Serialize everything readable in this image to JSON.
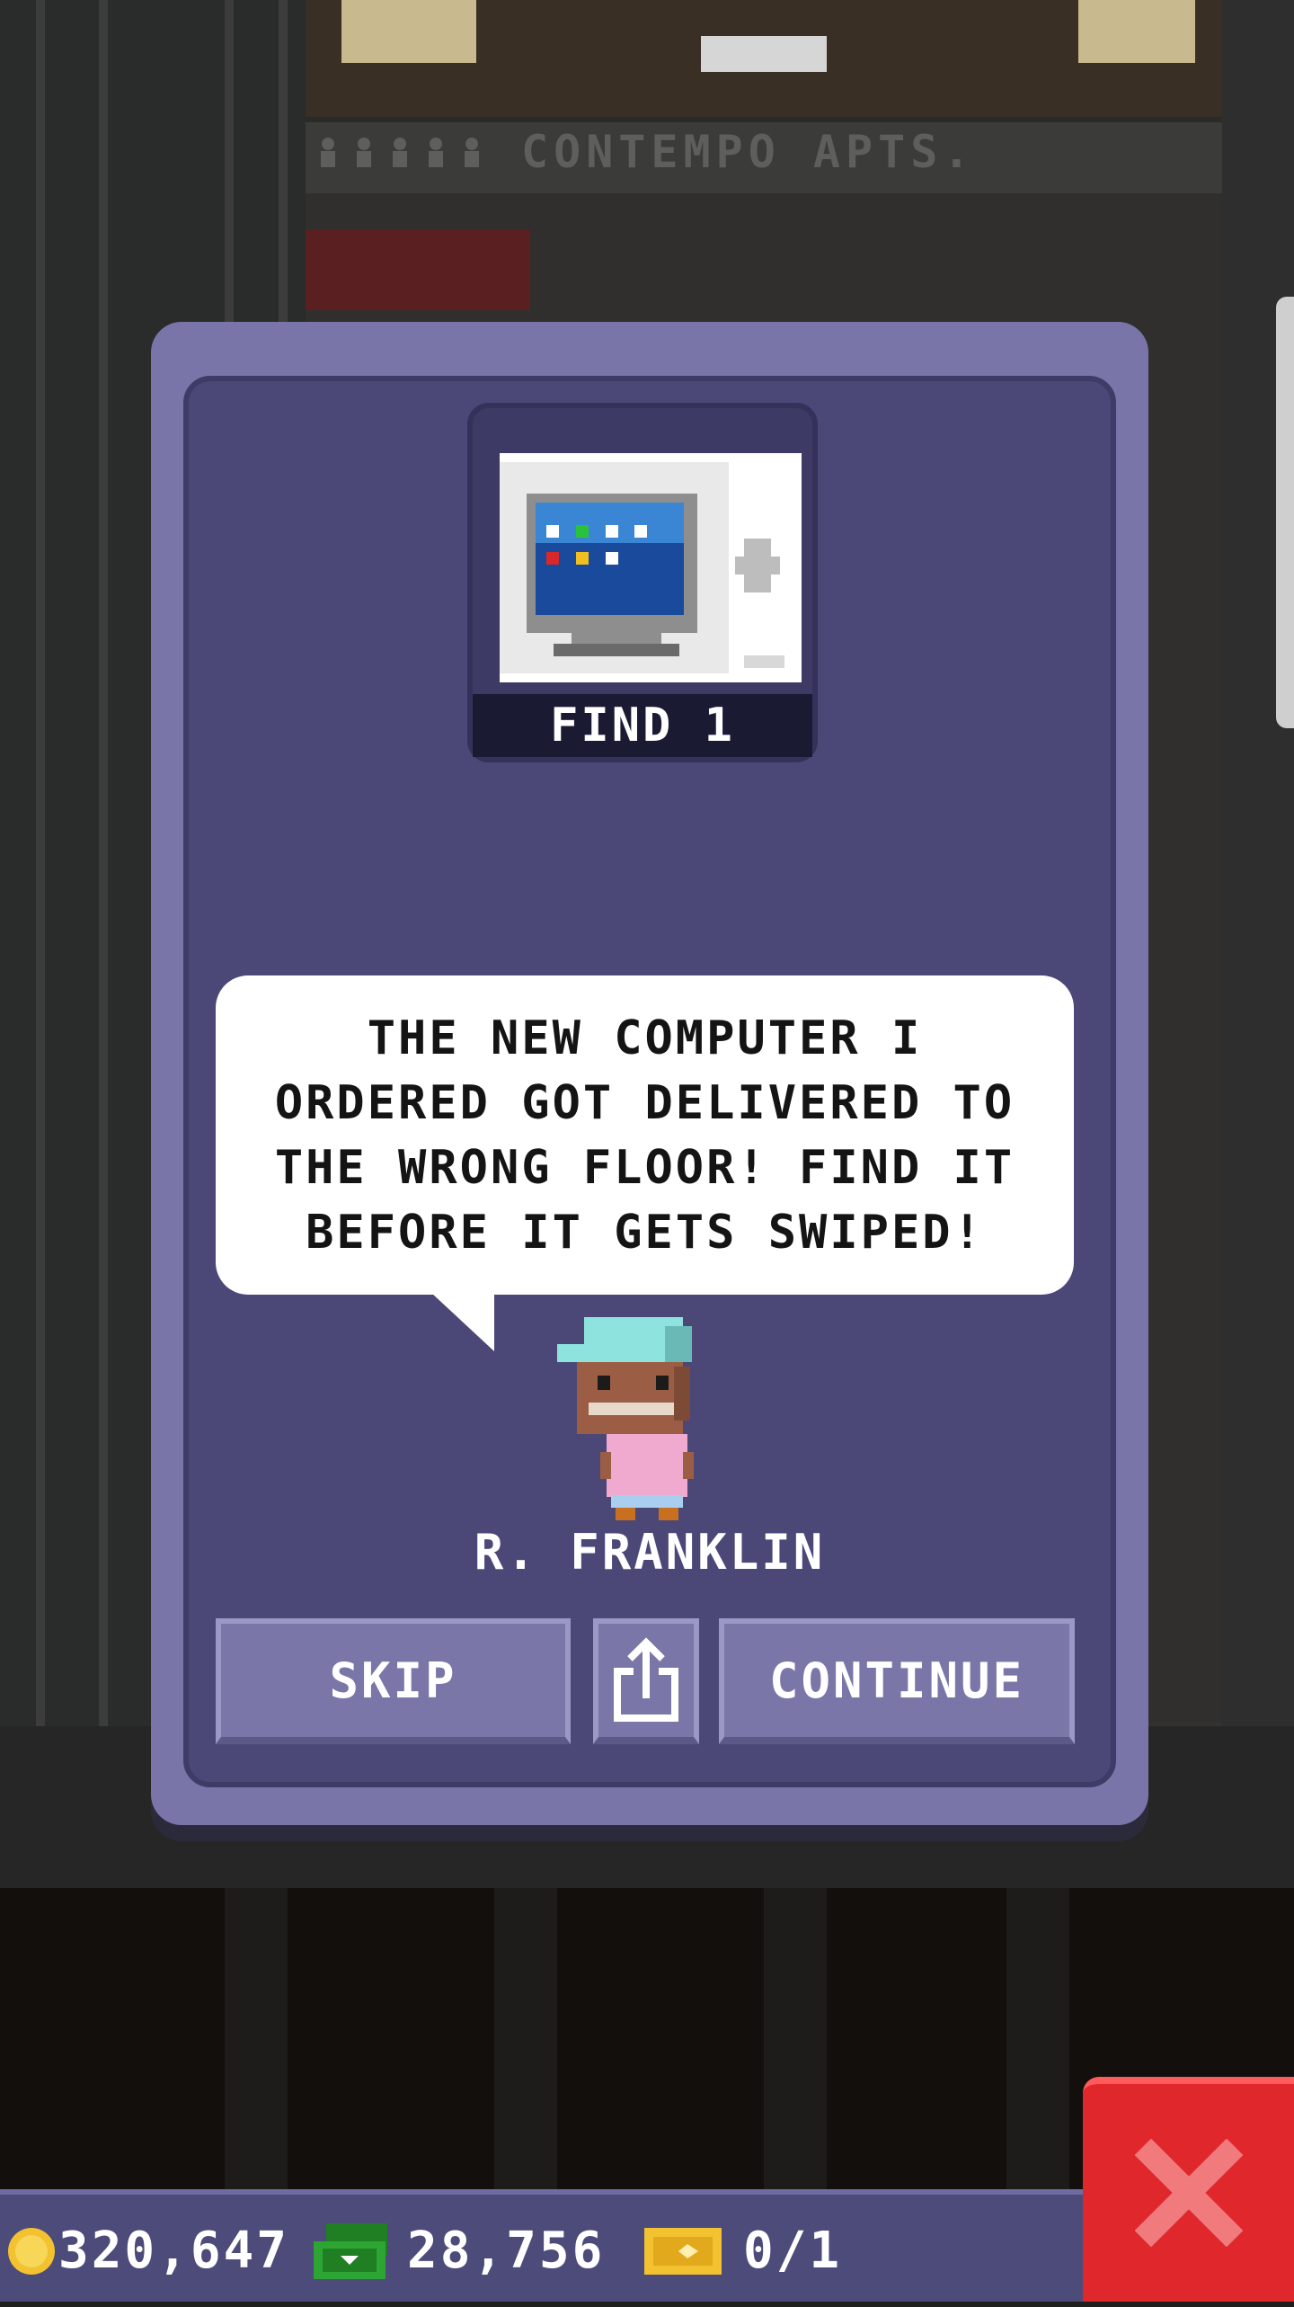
{
  "background": {
    "building_sign": "CONTEMPO APTS."
  },
  "mission": {
    "item_icon": "computer-monitor-icon",
    "find_label": "FIND 1",
    "message": "THE NEW COMPUTER I ORDERED GOT DELIVERED TO THE WRONG FLOOR! FIND IT BEFORE IT GETS SWIPED!",
    "character_name": "R. FRANKLIN"
  },
  "buttons": {
    "skip": "SKIP",
    "share_icon": "share-icon",
    "continue": "CONTINUE",
    "close_icon": "close-icon"
  },
  "status": {
    "coins": "320,647",
    "coin_icon": "coin-icon",
    "bux": "28,756",
    "bux_icon": "bux-icon",
    "tickets": "0/1",
    "ticket_icon": "ticket-icon"
  },
  "colors": {
    "dialog": "#7a75a8",
    "dialog_inner": "#4b4878",
    "close_button": "#e0282c",
    "status_bar": "#4c4b79"
  }
}
